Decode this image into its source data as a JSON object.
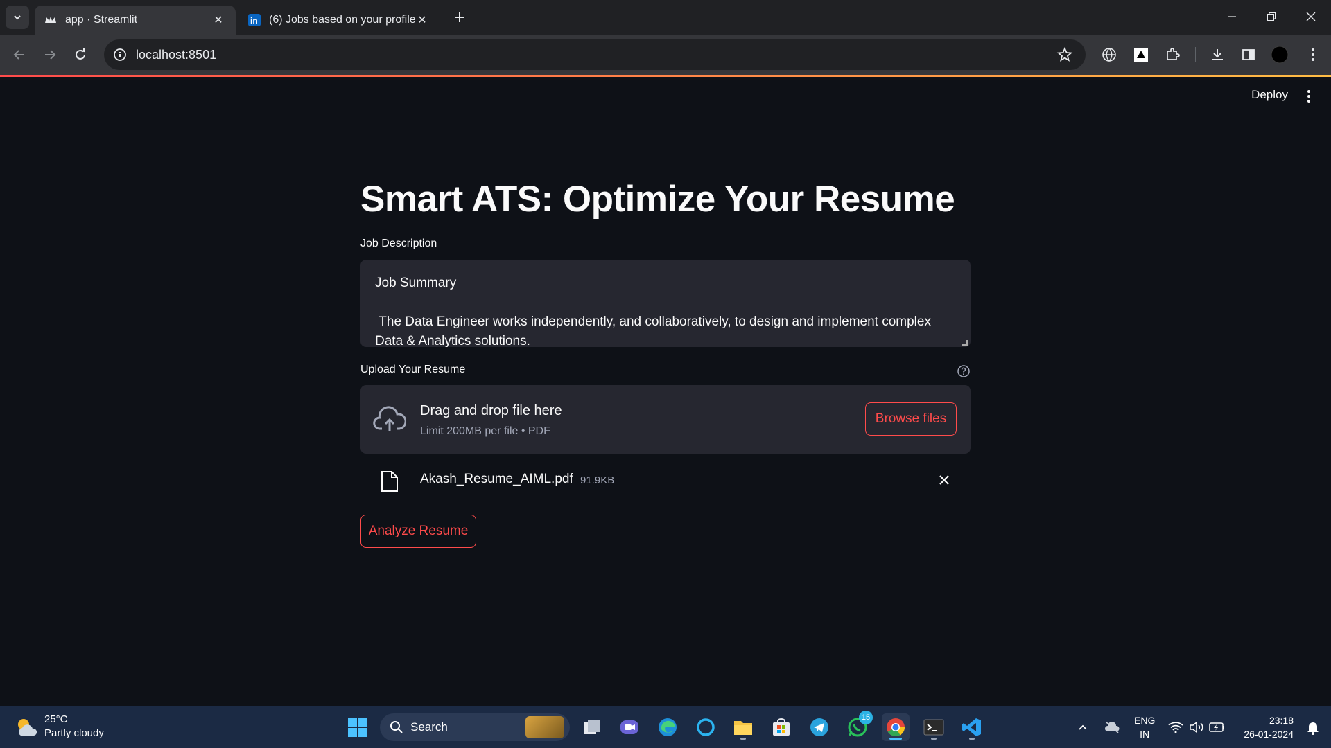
{
  "browser": {
    "tabs": [
      {
        "title": "app · Streamlit",
        "active": true,
        "icon": "streamlit-crown-icon"
      },
      {
        "title": "(6) Jobs based on your profile |",
        "active": false,
        "icon": "linkedin-icon"
      }
    ],
    "url": "localhost:8501"
  },
  "header": {
    "deploy_label": "Deploy"
  },
  "main": {
    "title": "Smart ATS: Optimize Your Resume",
    "job_description": {
      "label": "Job Description",
      "line1": "Job Summary",
      "line2": " The Data Engineer works independently, and collaboratively, to design and implement complex",
      "line3": "Data & Analytics solutions."
    },
    "upload": {
      "label": "Upload Your Resume",
      "dropzone_title": "Drag and drop file here",
      "dropzone_subtitle": "Limit 200MB per file • PDF",
      "browse_label": "Browse files",
      "file_name": "Akash_Resume_AIML.pdf",
      "file_size": "91.9KB"
    },
    "analyze_label": "Analyze Resume"
  },
  "taskbar": {
    "weather_temp": "25°C",
    "weather_desc": "Partly cloudy",
    "search_label": "Search",
    "whatsapp_badge": "15",
    "lang_line1": "ENG",
    "lang_line2": "IN",
    "time": "23:18",
    "date": "26-01-2024"
  },
  "colors": {
    "accent": "#ff4b4b",
    "app_bg": "#0e1117",
    "widget_bg": "#262730"
  }
}
